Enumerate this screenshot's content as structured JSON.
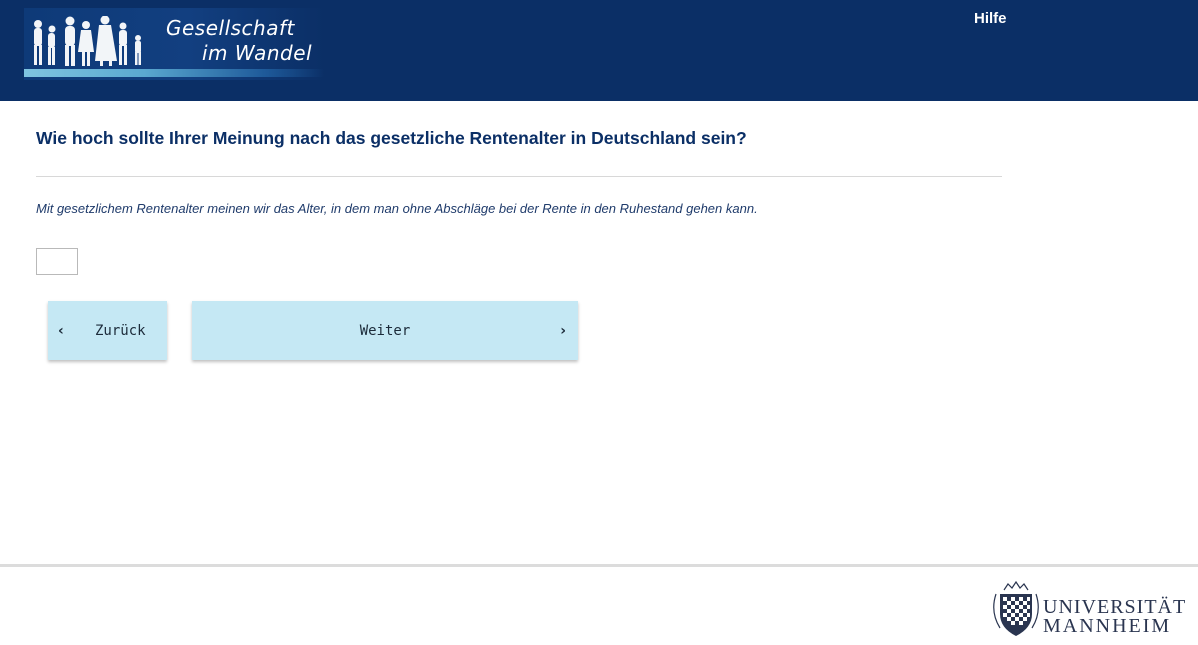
{
  "header": {
    "logo": {
      "line1": "Gesellschaft",
      "line2": "im Wandel"
    },
    "help_label": "Hilfe",
    "background": "#0b2f66"
  },
  "question": {
    "title": "Wie hoch sollte Ihrer Meinung nach das gesetzliche Rentenalter in Deutschland sein?",
    "hint": "Mit gesetzlichem Rentenalter meinen wir das Alter, in dem man ohne Abschläge bei der Rente in den Ruhestand gehen kann.",
    "answer_value": ""
  },
  "navigation": {
    "back_label": "Zurück",
    "back_icon": "chevron-left-icon",
    "next_label": "Weiter",
    "next_icon": "chevron-right-icon",
    "button_color": "#c5e8f4"
  },
  "footer": {
    "university_line1": "UNIVERSITÄT",
    "university_line2": "MANNHEIM"
  }
}
